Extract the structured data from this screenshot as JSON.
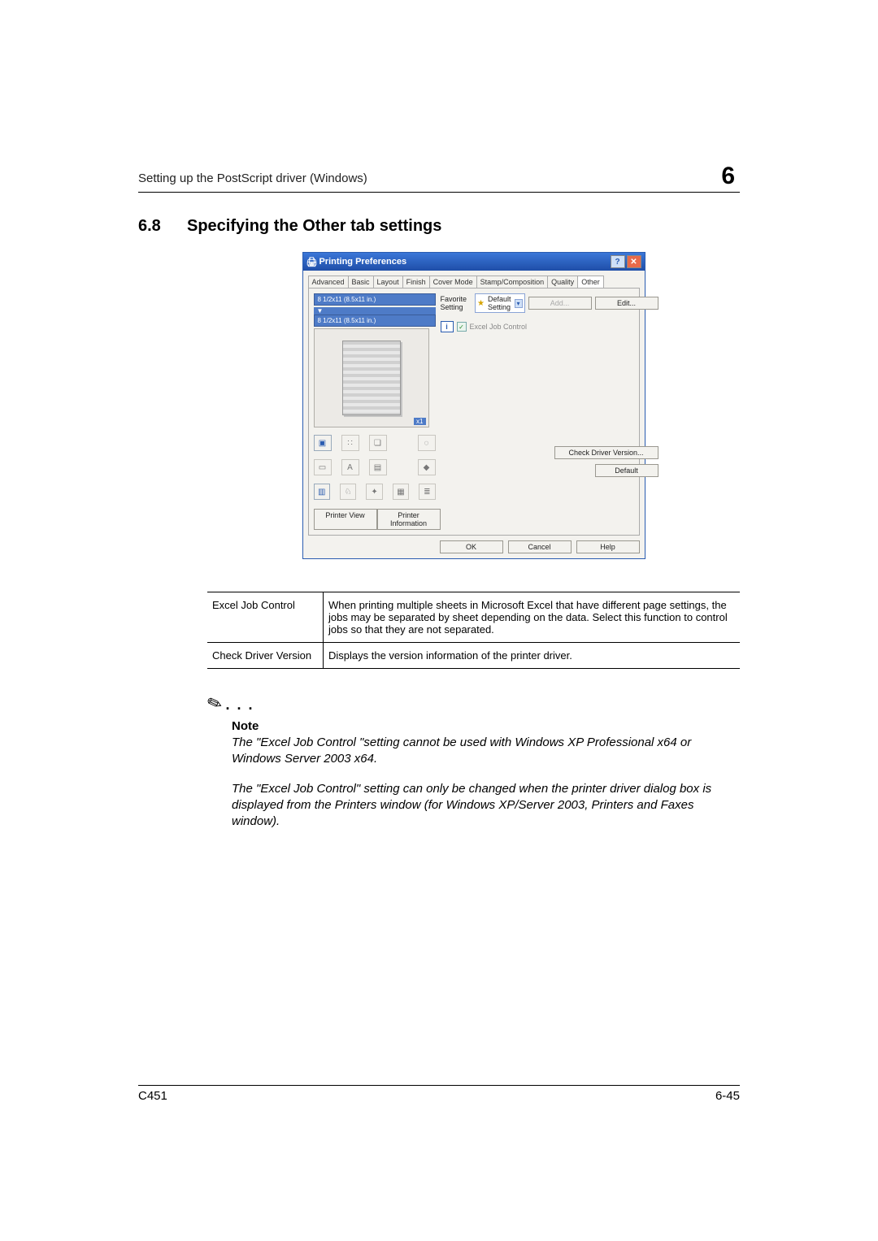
{
  "header": {
    "breadcrumb": "Setting up the PostScript driver (Windows)",
    "chapter": "6"
  },
  "section": {
    "number": "6.8",
    "title": "Specifying the Other tab settings"
  },
  "dialog": {
    "title": "Printing Preferences",
    "tabs": [
      "Advanced",
      "Basic",
      "Layout",
      "Finish",
      "Cover Mode",
      "Stamp/Composition",
      "Quality",
      "Other"
    ],
    "active_tab": "Other",
    "paper_from": "8 1/2x11 (8.5x11 in.)",
    "paper_to": "8 1/2x11 (8.5x11 in.)",
    "preview_tag": "x1",
    "printer_view": "Printer View",
    "printer_info": "Printer Information",
    "favorite_label": "Favorite Setting",
    "favorite_value": "Default Setting",
    "add_btn": "Add...",
    "edit_btn": "Edit...",
    "excel_label": "Excel Job Control",
    "check_ver": "Check Driver Version...",
    "default_btn": "Default",
    "ok": "OK",
    "cancel": "Cancel",
    "help": "Help"
  },
  "table": {
    "row1_name": "Excel Job Control",
    "row1_desc": "When printing multiple sheets in Microsoft Excel that have different page settings, the jobs may be separated by sheet depending on the data. Select this function to control jobs so that they are not separated.",
    "row2_name": "Check Driver Version",
    "row2_desc": "Displays the version information of the printer driver."
  },
  "note": {
    "heading": "Note",
    "para1": "The \"Excel Job Control \"setting cannot be used with Windows XP Professional x64 or Windows Server 2003 x64.",
    "para2": "The \"Excel Job Control\" setting can only be changed when the printer driver dialog box is displayed from the Printers window (for Windows XP/Server 2003, Printers and Faxes window)."
  },
  "footer": {
    "left": "C451",
    "right": "6-45"
  }
}
